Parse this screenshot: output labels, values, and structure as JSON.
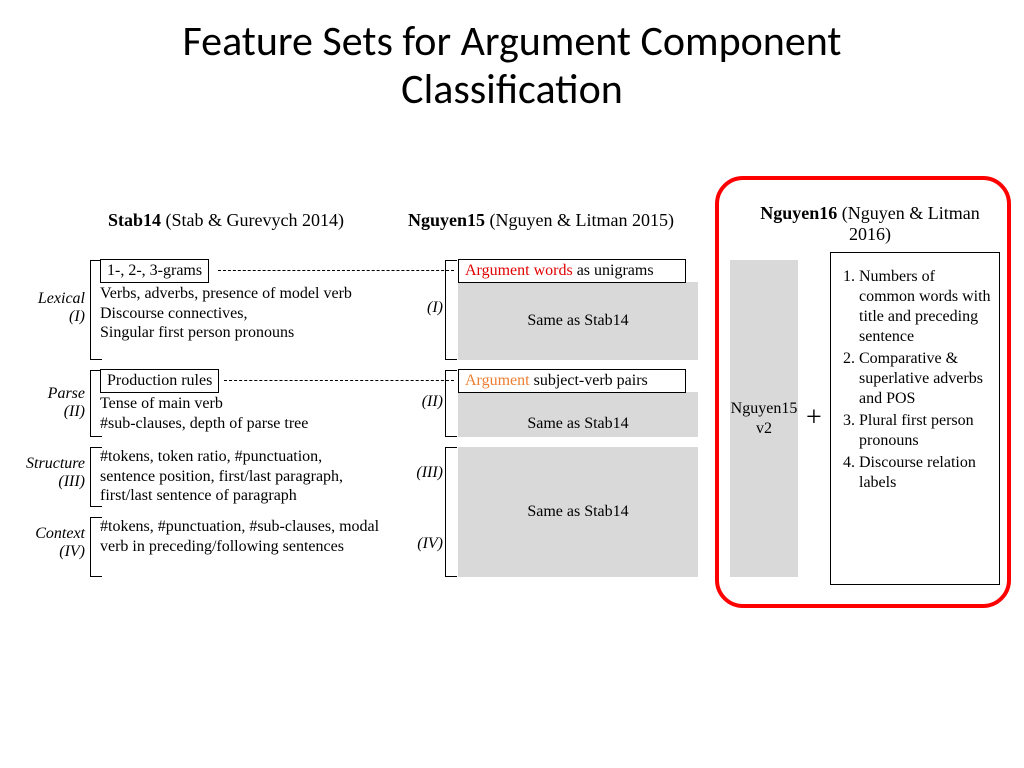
{
  "title_line1": "Feature Sets for Argument Component",
  "title_line2": "Classification",
  "columns": {
    "stab14": {
      "short": "Stab14",
      "full": " (Stab & Gurevych 2014)"
    },
    "nguyen15": {
      "short": "Nguyen15",
      "full": " (Nguyen & Litman 2015)"
    },
    "nguyen16": {
      "short": "Nguyen16",
      "full": " (Nguyen & Litman 2016)"
    }
  },
  "rows": {
    "r1": {
      "name": "Lexical",
      "num": "(I)"
    },
    "r2": {
      "name": "Parse",
      "num": "(II)"
    },
    "r3": {
      "name": "Structure",
      "num": "(III)"
    },
    "r4": {
      "name": "Context",
      "num": "(IV)"
    }
  },
  "stab14": {
    "r1_box": "1-, 2-, 3-grams",
    "r1_text": "Verbs, adverbs, presence of model verb\nDiscourse connectives,\nSingular first person pronouns",
    "r2_box": "Production rules",
    "r2_text": "Tense of main verb\n#sub-clauses, depth of parse tree",
    "r3_text": "#tokens, token ratio, #punctuation, sentence position, first/last paragraph, first/last sentence of paragraph",
    "r4_text": "#tokens, #punctuation, #sub-clauses, modal verb in preceding/following sentences"
  },
  "nguyen15": {
    "r1_hl": "Argument words",
    "r1_rest": " as unigrams",
    "r2_hl": "Argument",
    "r2_rest": " subject-verb pairs",
    "same": "Same as Stab14",
    "i": "(I)",
    "ii": "(II)",
    "iii": "(III)",
    "iv": "(IV)"
  },
  "nguyen16": {
    "base": "Nguyen15 v2",
    "plus": "+",
    "items": [
      "Numbers of common words with title and preceding sentence",
      "Comparative & superlative adverbs and POS",
      "Plural first person pronouns",
      "Discourse relation labels"
    ]
  }
}
